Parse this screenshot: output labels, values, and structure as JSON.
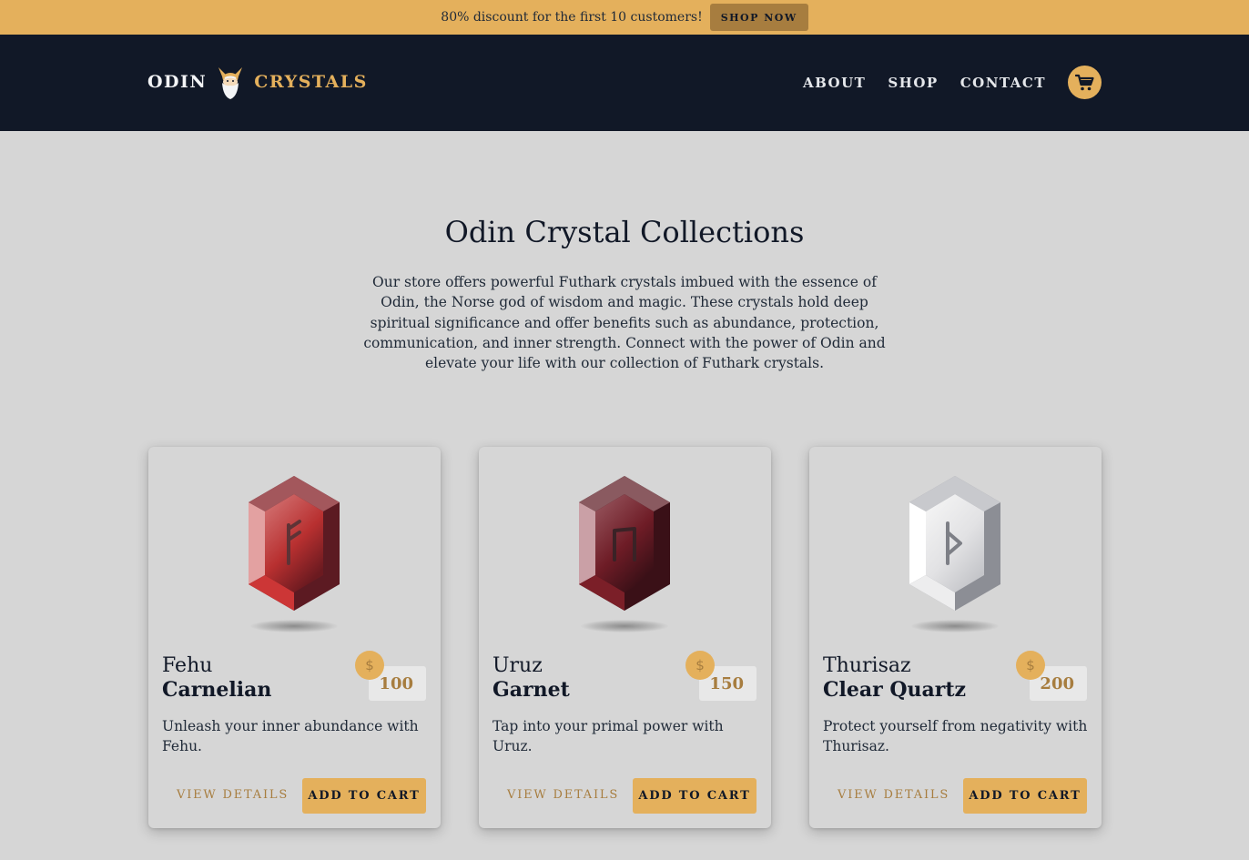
{
  "announcement": {
    "text": "80% discount for the first 10 customers!",
    "button": "SHOP NOW"
  },
  "brand": {
    "left": "ODIN",
    "right": "CRYSTALS",
    "icon": "viking-head-icon"
  },
  "nav": {
    "links": [
      "ABOUT",
      "SHOP",
      "CONTACT"
    ],
    "cart_icon": "cart-icon"
  },
  "hero": {
    "title": "Odin Crystal Collections",
    "description": "Our store offers powerful Futhark crystals imbued with the essence of Odin, the Norse god of wisdom and magic. These crystals hold deep spiritual significance and offer benefits such as abundance, protection, communication, and inner strength. Connect with the power of Odin and elevate your life with our collection of Futhark crystals."
  },
  "products": [
    {
      "rune": "Fehu",
      "crystal": "Carnelian",
      "price": "100",
      "currency": "$",
      "description": "Unleash your inner abundance with Fehu.",
      "details_label": "VIEW DETAILS",
      "cart_label": "ADD TO CART",
      "colors": {
        "light": "#e3a1a1",
        "mid": "#cc3636",
        "dark": "#5c1a22"
      }
    },
    {
      "rune": "Uruz",
      "crystal": "Garnet",
      "price": "150",
      "currency": "$",
      "description": "Tap into your primal power with Uruz.",
      "details_label": "VIEW DETAILS",
      "cart_label": "ADD TO CART",
      "colors": {
        "light": "#caa0a6",
        "mid": "#7b1f28",
        "dark": "#3a1017"
      }
    },
    {
      "rune": "Thurisaz",
      "crystal": "Clear Quartz",
      "price": "200",
      "currency": "$",
      "description": "Protect yourself from negativity with Thurisaz.",
      "details_label": "VIEW DETAILS",
      "cart_label": "ADD TO CART",
      "colors": {
        "light": "#fafafa",
        "mid": "#dedede",
        "dark": "#8c8e95"
      }
    }
  ],
  "accent": "#e4b05c",
  "dark": "#111827"
}
